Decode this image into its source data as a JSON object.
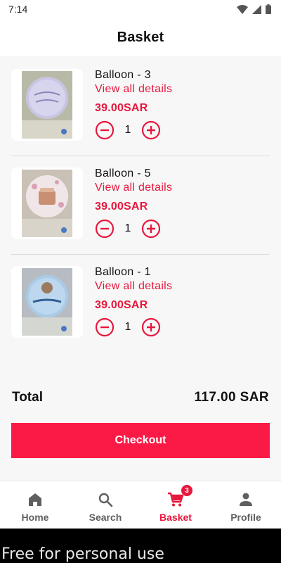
{
  "status_bar": {
    "time": "7:14"
  },
  "header": {
    "title": "Basket"
  },
  "items": [
    {
      "name": "Balloon - 3",
      "details_link": "View all details",
      "price": "39.00SAR",
      "quantity": "1"
    },
    {
      "name": "Balloon - 5",
      "details_link": "View all details",
      "price": "39.00SAR",
      "quantity": "1"
    },
    {
      "name": "Balloon - 1",
      "details_link": "View all details",
      "price": "39.00SAR",
      "quantity": "1"
    }
  ],
  "summary": {
    "total_label": "Total",
    "total_value": "117.00 SAR"
  },
  "checkout": {
    "label": "Checkout"
  },
  "bottom_nav": [
    {
      "label": "Home",
      "icon": "home-icon",
      "active": false
    },
    {
      "label": "Search",
      "icon": "search-icon",
      "active": false
    },
    {
      "label": "Basket",
      "icon": "cart-icon",
      "active": true,
      "badge": "3"
    },
    {
      "label": "Profile",
      "icon": "person-icon",
      "active": false
    }
  ],
  "watermark": {
    "text": "Free for personal use"
  },
  "colors": {
    "accent": "#e8173d",
    "checkout_bg": "#fb1a46",
    "background": "#f7f7f7",
    "nav_inactive": "#5f5f5f"
  }
}
